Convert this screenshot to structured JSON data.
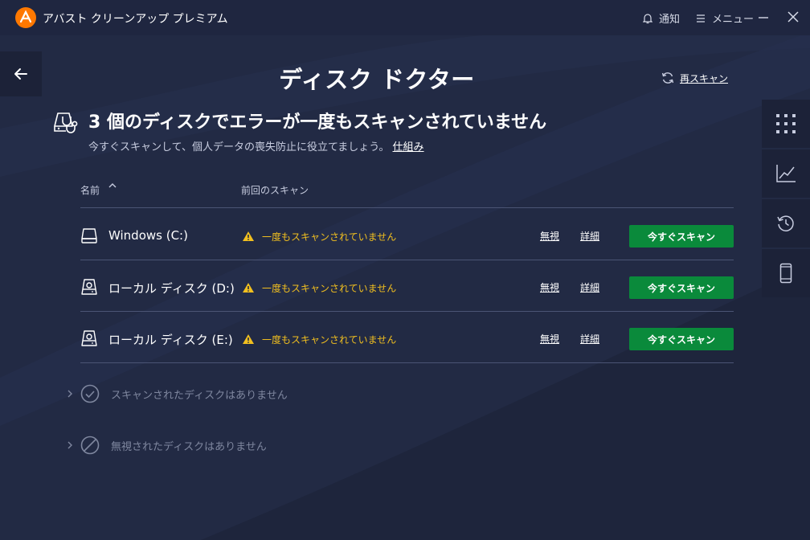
{
  "app": {
    "title": "アバスト クリーンアップ プレミアム",
    "notify_label": "通知",
    "menu_label": "メニュー"
  },
  "page": {
    "title": "ディスク ドクター",
    "rescan_label": "再スキャン",
    "headline": "3 個のディスクでエラーが一度もスキャンされていません",
    "subline": "今すぐスキャンして、個人データの喪失防止に役立てましょう。",
    "how_it_works": "仕組み"
  },
  "table": {
    "col_name": "名前",
    "col_last_scan": "前回のスキャン",
    "rows": [
      {
        "name": "Windows (C:)",
        "status": "一度もスキャンされていません",
        "ignore": "無視",
        "detail": "詳細",
        "scan": "今すぐスキャン"
      },
      {
        "name": "ローカル ディスク (D:)",
        "status": "一度もスキャンされていません",
        "ignore": "無視",
        "detail": "詳細",
        "scan": "今すぐスキャン"
      },
      {
        "name": "ローカル ディスク (E:)",
        "status": "一度もスキャンされていません",
        "ignore": "無視",
        "detail": "詳細",
        "scan": "今すぐスキャン"
      }
    ]
  },
  "sections": {
    "scanned_empty": "スキャンされたディスクはありません",
    "ignored_empty": "無視されたディスクはありません"
  },
  "icons": {
    "logo": "avast-logo-icon",
    "bell": "bell-icon",
    "menu": "hamburger-icon",
    "back": "arrow-left-icon",
    "rescan": "refresh-icon",
    "rail": [
      "grid-icon",
      "chart-icon",
      "history-icon",
      "mobile-icon"
    ]
  },
  "colors": {
    "background": "#222a44",
    "titlebar": "#1f2640",
    "accent_orange": "#ff7800",
    "warning": "#f1bf1f",
    "scan_button": "#0a8a3b"
  }
}
